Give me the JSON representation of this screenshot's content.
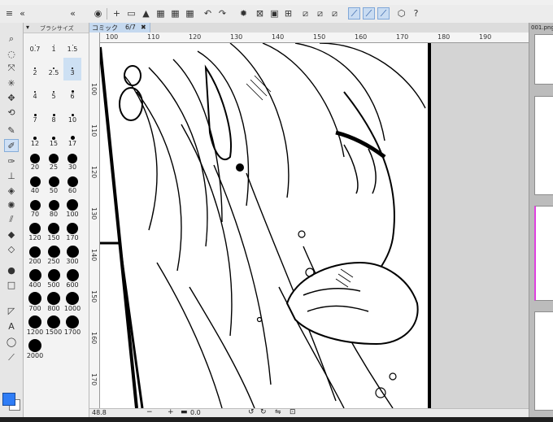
{
  "canvas_tab": {
    "name": "コミック",
    "page": "6/7",
    "close": "✖"
  },
  "brush_panel": {
    "title": "ブラシサイズ",
    "sizes": [
      "0.7",
      "1",
      "1.5",
      "2",
      "2.5",
      "3",
      "4",
      "5",
      "6",
      "7",
      "8",
      "10",
      "12",
      "15",
      "17",
      "20",
      "25",
      "30",
      "40",
      "50",
      "60",
      "70",
      "80",
      "100",
      "120",
      "150",
      "170",
      "200",
      "250",
      "300",
      "400",
      "500",
      "600",
      "700",
      "800",
      "1000",
      "1200",
      "1500",
      "1700",
      "2000"
    ],
    "selected": "3"
  },
  "hruler_labels": [
    "100",
    "110",
    "120",
    "130",
    "140",
    "150",
    "160",
    "170",
    "180",
    "190"
  ],
  "vruler_labels": [
    "100",
    "110",
    "120",
    "130",
    "140",
    "150",
    "160",
    "170"
  ],
  "right_panel": {
    "file_label": "001.png"
  },
  "status": {
    "zoom": "48.8",
    "angle": "0.0"
  },
  "toolbar_icons": [
    "zoom-icon",
    "lasso-icon",
    "move-icon",
    "wand-icon",
    "object-icon",
    "rotate-icon",
    "pen-icon",
    "marker-icon",
    "brush-icon",
    "fill-icon",
    "blend-icon",
    "airbrush-icon",
    "eyedropper-icon",
    "gradient-icon",
    "eraser-icon",
    "shape-icon",
    "rect-icon",
    "text-icon",
    "balloon-icon",
    "line-icon"
  ],
  "colors": {
    "main": "#2f7df6",
    "sub": "#ffffff",
    "accent": "#c9dcf2"
  }
}
